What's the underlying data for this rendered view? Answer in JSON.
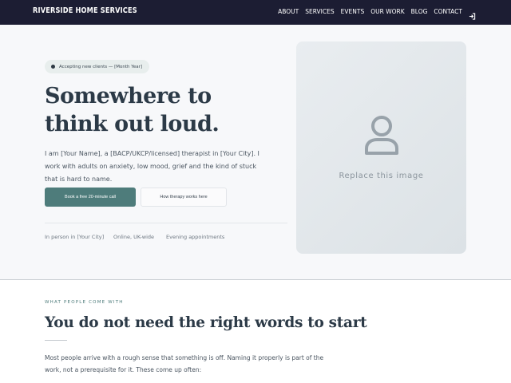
{
  "nav": {
    "brand": "RIVERSIDE HOME SERVICES",
    "links": [
      "ABOUT",
      "SERVICES",
      "EVENTS",
      "OUR WORK",
      "BLOG",
      "CONTACT"
    ],
    "login_icon": "login-icon"
  },
  "hero": {
    "badge": "Accepting new clients — [Month Year]",
    "headline": "Somewhere to think out loud.",
    "intro": "I am [Your Name], a [BACP/UKCP/licensed] therapist in [Your City]. I work with adults on anxiety, low mood, grief and the kind of stuck that is hard to name.",
    "primary_cta": "Book a free 20-minute call",
    "secondary_cta": "How therapy works here",
    "meta": [
      "In person in [Your City]",
      "Online, UK-wide",
      "Evening appointments"
    ],
    "photo_placeholder": "Replace this image",
    "photo_icon": "user-icon"
  },
  "section": {
    "eyebrow": "WHAT PEOPLE COME WITH",
    "title": "You do not need the right words to start",
    "body": "Most people arrive with a rough sense that something is off. Naming it properly is part of the work, not a prerequisite for it. These come up often:"
  },
  "colors": {
    "nav_bg": "#1c1d33",
    "accent": "#4e7c7b",
    "heading": "#2c3a47"
  }
}
